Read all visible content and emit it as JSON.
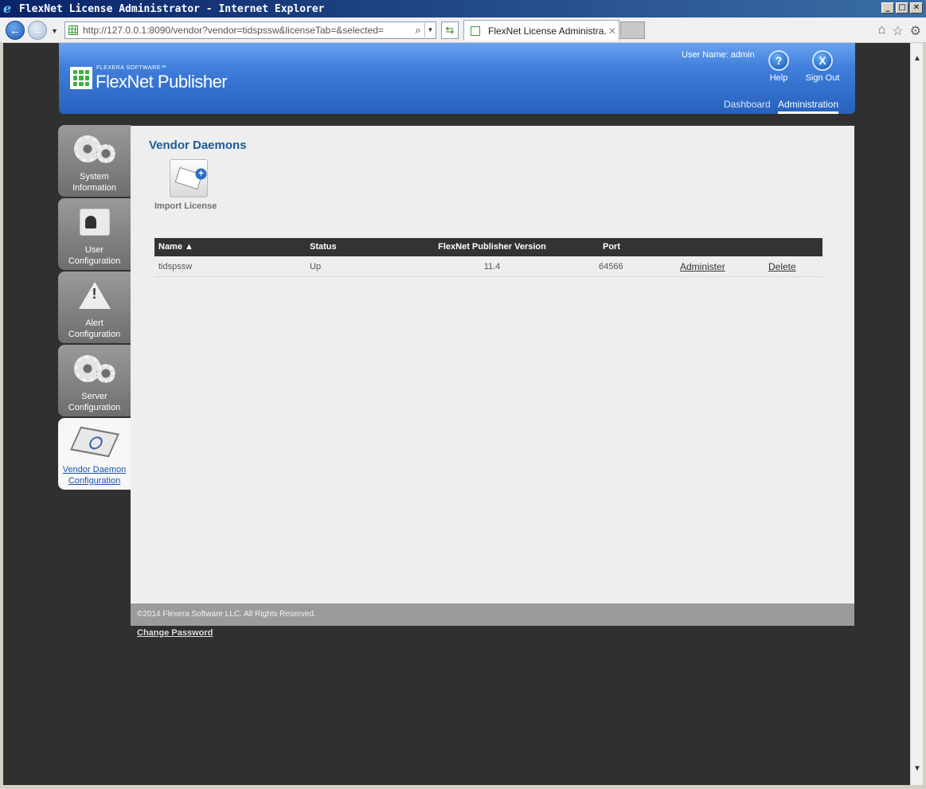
{
  "window": {
    "title": "FlexNet License Administrator - Internet Explorer"
  },
  "browser": {
    "url": "http://127.0.0.1:8090/vendor?vendor=tidspssw&licenseTab=&selected=",
    "tab_title": "FlexNet License Administra..."
  },
  "header": {
    "brand_small": "FLEXERA SOFTWARE™",
    "brand": "FlexNet Publisher",
    "user_label": "User Name: admin",
    "help_label": "Help",
    "signout_label": "Sign Out",
    "tabs": [
      "Dashboard",
      "Administration"
    ]
  },
  "sidebar": {
    "items": [
      {
        "label": "System Information",
        "icon": "gears-icon"
      },
      {
        "label": "User Configuration",
        "icon": "id-badge-icon"
      },
      {
        "label": "Alert Configuration",
        "icon": "warning-icon"
      },
      {
        "label": "Server Configuration",
        "icon": "gears-icon"
      },
      {
        "label": "Vendor Daemon Configuration",
        "icon": "certificate-icon",
        "active": true
      }
    ]
  },
  "main": {
    "title": "Vendor Daemons",
    "import_label": "Import License",
    "table": {
      "headers": [
        "Name ▲",
        "Status",
        "FlexNet Publisher Version",
        "Port"
      ],
      "rows": [
        {
          "name": "tidspssw",
          "status": "Up",
          "version": "11.4",
          "port": "64566",
          "administer": "Administer",
          "delete": "Delete"
        }
      ]
    }
  },
  "footer": {
    "copyright": "©2014 Flexera Software LLC. All Rights Reserved.",
    "change_password": "Change Password"
  },
  "colors": {
    "accent": "#1c5a99",
    "header_blue": "#3f7edb",
    "table_header": "#333333"
  }
}
